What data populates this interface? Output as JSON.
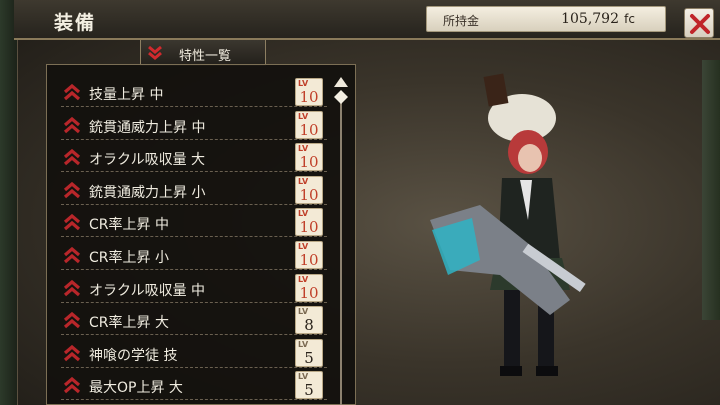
{
  "header": {
    "title": "装備",
    "money_label": "所持金",
    "money_value": "105,792",
    "money_unit": "fc"
  },
  "trait_tab": {
    "label": "特性一覧"
  },
  "traits": [
    {
      "label": "技量上昇 中",
      "lv_tag": "LV",
      "level": "10",
      "max": true
    },
    {
      "label": "銃貫通威力上昇 中",
      "lv_tag": "LV",
      "level": "10",
      "max": true
    },
    {
      "label": "オラクル吸収量 大",
      "lv_tag": "LV",
      "level": "10",
      "max": true
    },
    {
      "label": "銃貫通威力上昇 小",
      "lv_tag": "LV",
      "level": "10",
      "max": true
    },
    {
      "label": "CR率上昇 中",
      "lv_tag": "LV",
      "level": "10",
      "max": true
    },
    {
      "label": "CR率上昇 小",
      "lv_tag": "LV",
      "level": "10",
      "max": true
    },
    {
      "label": "オラクル吸収量 中",
      "lv_tag": "LV",
      "level": "10",
      "max": true
    },
    {
      "label": "CR率上昇 大",
      "lv_tag": "LV",
      "level": "8",
      "max": false
    },
    {
      "label": "神喰の学徒 技",
      "lv_tag": "LV",
      "level": "5",
      "max": false
    },
    {
      "label": "最大OP上昇 大",
      "lv_tag": "LV",
      "level": "5",
      "max": false
    }
  ],
  "colors": {
    "accent_red": "#c0402a",
    "chevron_red": "#b8262a",
    "panel_bg": "#12100d",
    "header_bg": "#3e392f"
  },
  "icons": {
    "close": "close-icon",
    "row_chevron": "double-chevron-up-icon",
    "tab_chevron": "double-chevron-down-icon",
    "scroll_up": "triangle-up-icon",
    "scroll_thumb": "diamond-icon"
  }
}
